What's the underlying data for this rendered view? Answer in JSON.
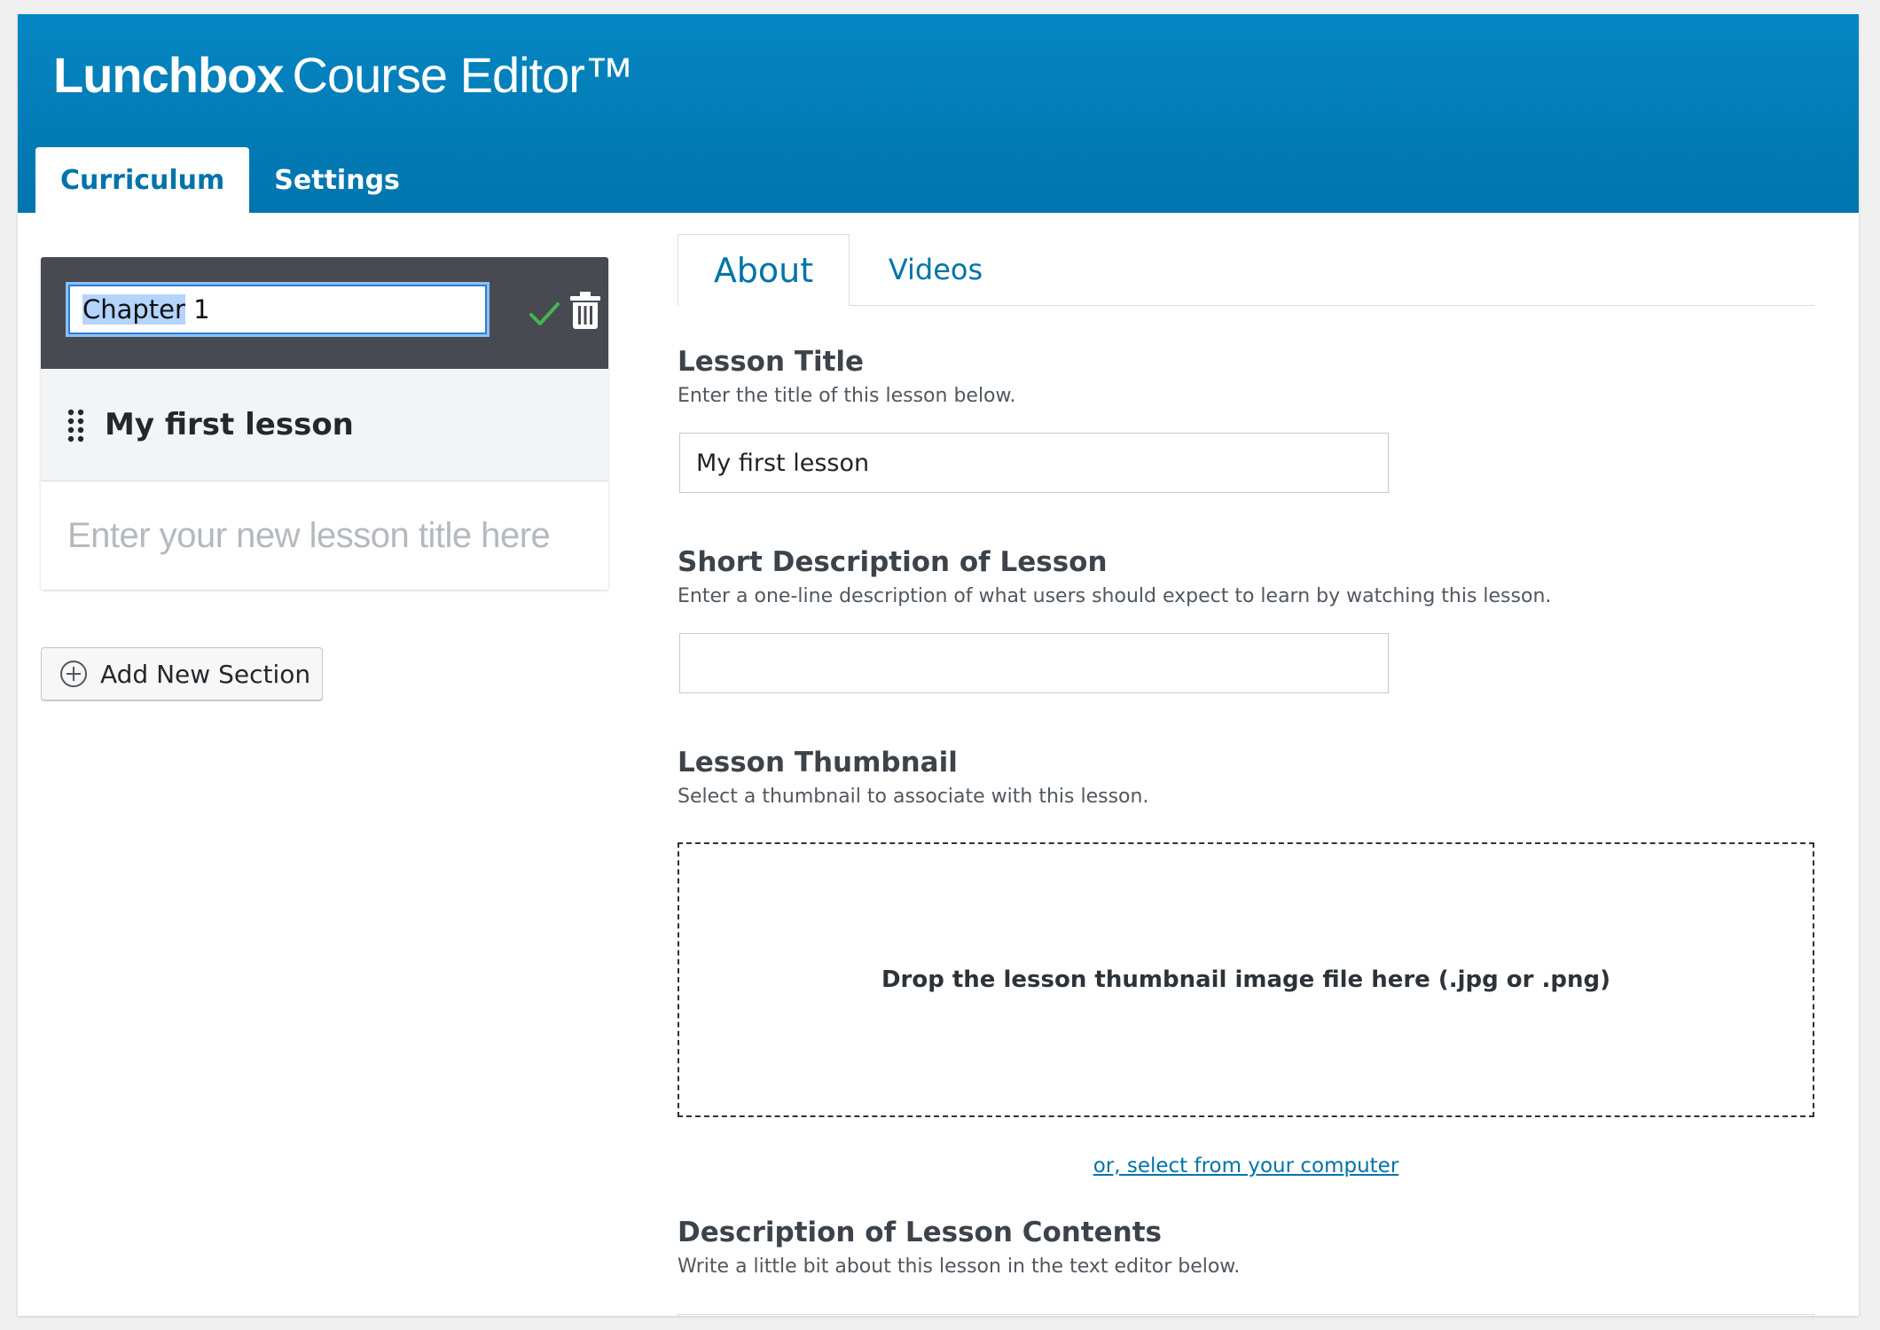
{
  "header": {
    "brand_bold": "Lunchbox",
    "brand_light": "Course Editor™",
    "tabs": [
      {
        "label": "Curriculum",
        "active": true
      },
      {
        "label": "Settings",
        "active": false
      }
    ]
  },
  "sidebar": {
    "section_title_selected": "Chapter",
    "section_title_rest": " 1",
    "lessons": [
      {
        "label": "My first lesson"
      }
    ],
    "new_lesson_placeholder": "Enter your new lesson title here",
    "add_section_label": "Add New Section"
  },
  "content": {
    "tabs": [
      {
        "label": "About",
        "active": true
      },
      {
        "label": "Videos",
        "active": false
      }
    ],
    "lesson_title": {
      "label": "Lesson Title",
      "help": "Enter the title of this lesson below.",
      "value": "My first lesson"
    },
    "short_description": {
      "label": "Short Description of Lesson",
      "help": "Enter a one-line description of what users should expect to learn by watching this lesson.",
      "value": ""
    },
    "thumbnail": {
      "label": "Lesson Thumbnail",
      "help": "Select a thumbnail to associate with this lesson.",
      "drop_text": "Drop the lesson thumbnail image file here (.jpg or .png)",
      "select_link": "or, select from your computer"
    },
    "contents": {
      "label": "Description of Lesson Contents",
      "help": "Write a little bit about this lesson in the text editor below."
    }
  },
  "colors": {
    "header_bg": "#0280bc",
    "accent_link": "#0073aa",
    "section_head_bg": "#484a51",
    "check_green": "#46b450"
  },
  "icons": {
    "confirm": "check-icon",
    "delete": "trash-icon",
    "drag": "drag-handle-icon",
    "add": "plus-circle-icon"
  }
}
